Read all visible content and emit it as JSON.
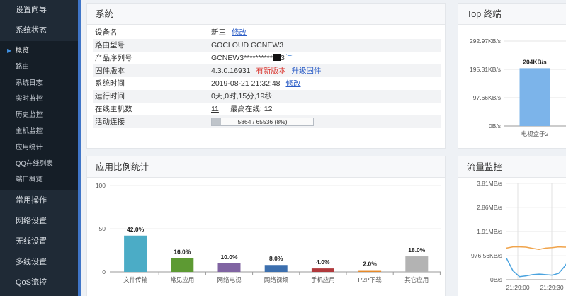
{
  "sidebar": {
    "top_items": [
      {
        "label": "设置向导"
      },
      {
        "label": "系统状态"
      }
    ],
    "sub_items": [
      {
        "label": "概览",
        "active": true
      },
      {
        "label": "路由"
      },
      {
        "label": "系统日志"
      },
      {
        "label": "实时监控"
      },
      {
        "label": "历史监控"
      },
      {
        "label": "主机监控"
      },
      {
        "label": "应用统计"
      },
      {
        "label": "QQ在线列表"
      },
      {
        "label": "端口概览"
      }
    ],
    "bottom_items": [
      {
        "label": "常用操作"
      },
      {
        "label": "网络设置"
      },
      {
        "label": "无线设置"
      },
      {
        "label": "多线设置"
      },
      {
        "label": "QoS流控"
      }
    ]
  },
  "system": {
    "title": "系统",
    "device_name_label": "设备名",
    "device_name": "新三",
    "edit_label": "修改",
    "model_label": "路由型号",
    "model": "GOCLOUD GCNEW3",
    "serial_label": "产品序列号",
    "serial": "GCNEW3**********",
    "serial_tail": "3",
    "firmware_label": "固件版本",
    "firmware": "4.3.0.16931",
    "new_version_label": "有新版本",
    "upgrade_label": "升级固件",
    "time_label": "系统时间",
    "time": "2019-08-21 21:32:48",
    "time_edit_label": "修改",
    "uptime_label": "运行时间",
    "uptime": "0天,0时,15分,19秒",
    "hosts_label": "在线主机数",
    "hosts": "11",
    "max_online_label": "最高在线:",
    "max_online": "12",
    "conn_label": "活动连接",
    "conn_text": "5864 / 65536 (8%)",
    "conn_fraction": 0.0895
  },
  "top_terminal": {
    "title": "Top 终端"
  },
  "app_stats": {
    "title": "应用比例统计"
  },
  "flow": {
    "title": "流量监控"
  },
  "chart_data": [
    {
      "type": "bar",
      "categories": [
        "电视盒子2"
      ],
      "values": [
        204
      ],
      "value_labels": [
        "204KB/s"
      ],
      "yticks": [
        "292.97KB/s",
        "195.31KB/s",
        "97.66KB/s",
        "0B/s"
      ],
      "ytick_values": [
        300,
        200,
        100,
        0
      ],
      "ylim": [
        0,
        300
      ],
      "color": "#7cb4ea",
      "grid": true
    },
    {
      "type": "bar",
      "categories": [
        "文件传输",
        "常见应用",
        "网络电视",
        "网络视频",
        "手机应用",
        "P2P下载",
        "其它应用"
      ],
      "values": [
        42.0,
        16.0,
        10.0,
        8.0,
        4.0,
        2.0,
        18.0
      ],
      "value_labels": [
        "42.0%",
        "16.0%",
        "10.0%",
        "8.0%",
        "4.0%",
        "2.0%",
        "18.0%"
      ],
      "colors": [
        "#4bacc6",
        "#5d9a33",
        "#8064a2",
        "#3c6fae",
        "#b0393c",
        "#e68a2a",
        "#b3b3b3"
      ],
      "yticks": [
        "100",
        "50",
        "0"
      ],
      "ytick_values": [
        100,
        50,
        0
      ],
      "ylim": [
        0,
        100
      ],
      "grid": true
    },
    {
      "type": "line",
      "yticks": [
        "3.81MB/s",
        "2.86MB/s",
        "1.91MB/s",
        "976.56KB/s",
        "0B/s"
      ],
      "ytick_values": [
        3.81,
        2.86,
        1.91,
        0.95,
        0
      ],
      "ylim": [
        0,
        3.81
      ],
      "xticks": [
        "21:29:00",
        "21:29:30"
      ],
      "grid": true,
      "series": [
        {
          "color": "#f0a34a",
          "values": [
            1.25,
            1.3,
            1.3,
            1.29,
            1.24,
            1.2,
            1.25,
            1.27,
            1.3,
            1.29,
            1.3
          ]
        },
        {
          "color": "#4aa3df",
          "values": [
            0.85,
            0.35,
            0.12,
            0.15,
            0.2,
            0.22,
            0.2,
            0.18,
            0.25,
            0.55,
            0.95
          ]
        }
      ]
    }
  ]
}
